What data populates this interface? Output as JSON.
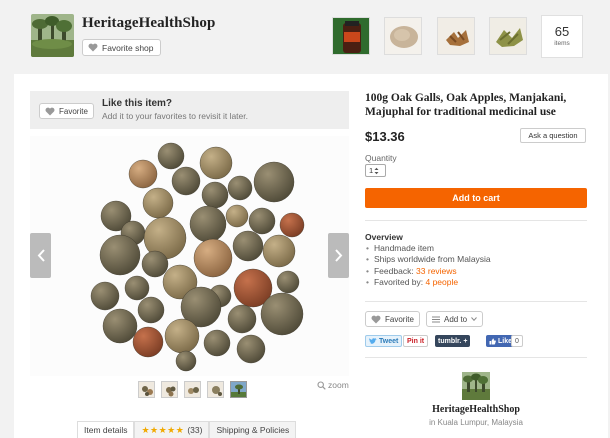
{
  "header": {
    "shop_name": "HeritageHealthShop",
    "favorite_shop_label": "Favorite shop",
    "items_count": "65",
    "items_label": "items"
  },
  "like_bar": {
    "favorite_label": "Favorite",
    "title": "Like this item?",
    "subtitle": "Add it to your favorites to revisit it later."
  },
  "gallery": {
    "zoom_label": "zoom",
    "thumbnail_count": 5,
    "active_thumbnail": 5
  },
  "tabs": {
    "item_details": "Item details",
    "rating_stars": "★★★★★",
    "rating_value": 5,
    "reviews_count": "(33)",
    "shipping": "Shipping & Policies"
  },
  "listing": {
    "title": "100g Oak Galls, Oak Apples, Manjakani, Majuphal for traditional medicinal use",
    "price": "$13.36",
    "ask_question_label": "Ask a question",
    "quantity_label": "Quantity",
    "quantity_value": "1",
    "add_to_cart_label": "Add to cart"
  },
  "overview": {
    "title": "Overview",
    "item_1": "Handmade item",
    "item_2": "Ships worldwide from Malaysia",
    "feedback_prefix": "Feedback: ",
    "feedback_link": "33 reviews",
    "favorited_prefix": "Favorited by: ",
    "favorited_link": "4 people"
  },
  "actions": {
    "favorite_label": "Favorite",
    "add_to_label": "Add to"
  },
  "social": {
    "tweet": "Tweet",
    "pinit": "Pin it",
    "tumblr": "tumblr.",
    "tumblr_plus": "+",
    "like": "Like",
    "like_count": "0"
  },
  "seller": {
    "name": "HeritageHealthShop",
    "location_prefix": "in ",
    "location": "Kuala Lumpur, Malaysia"
  },
  "colors": {
    "accent": "#f56400",
    "star": "#f1a900",
    "twitter": "#55acee",
    "pinterest": "#cb2027",
    "tumblr": "#35465c",
    "facebook": "#4267b2"
  }
}
